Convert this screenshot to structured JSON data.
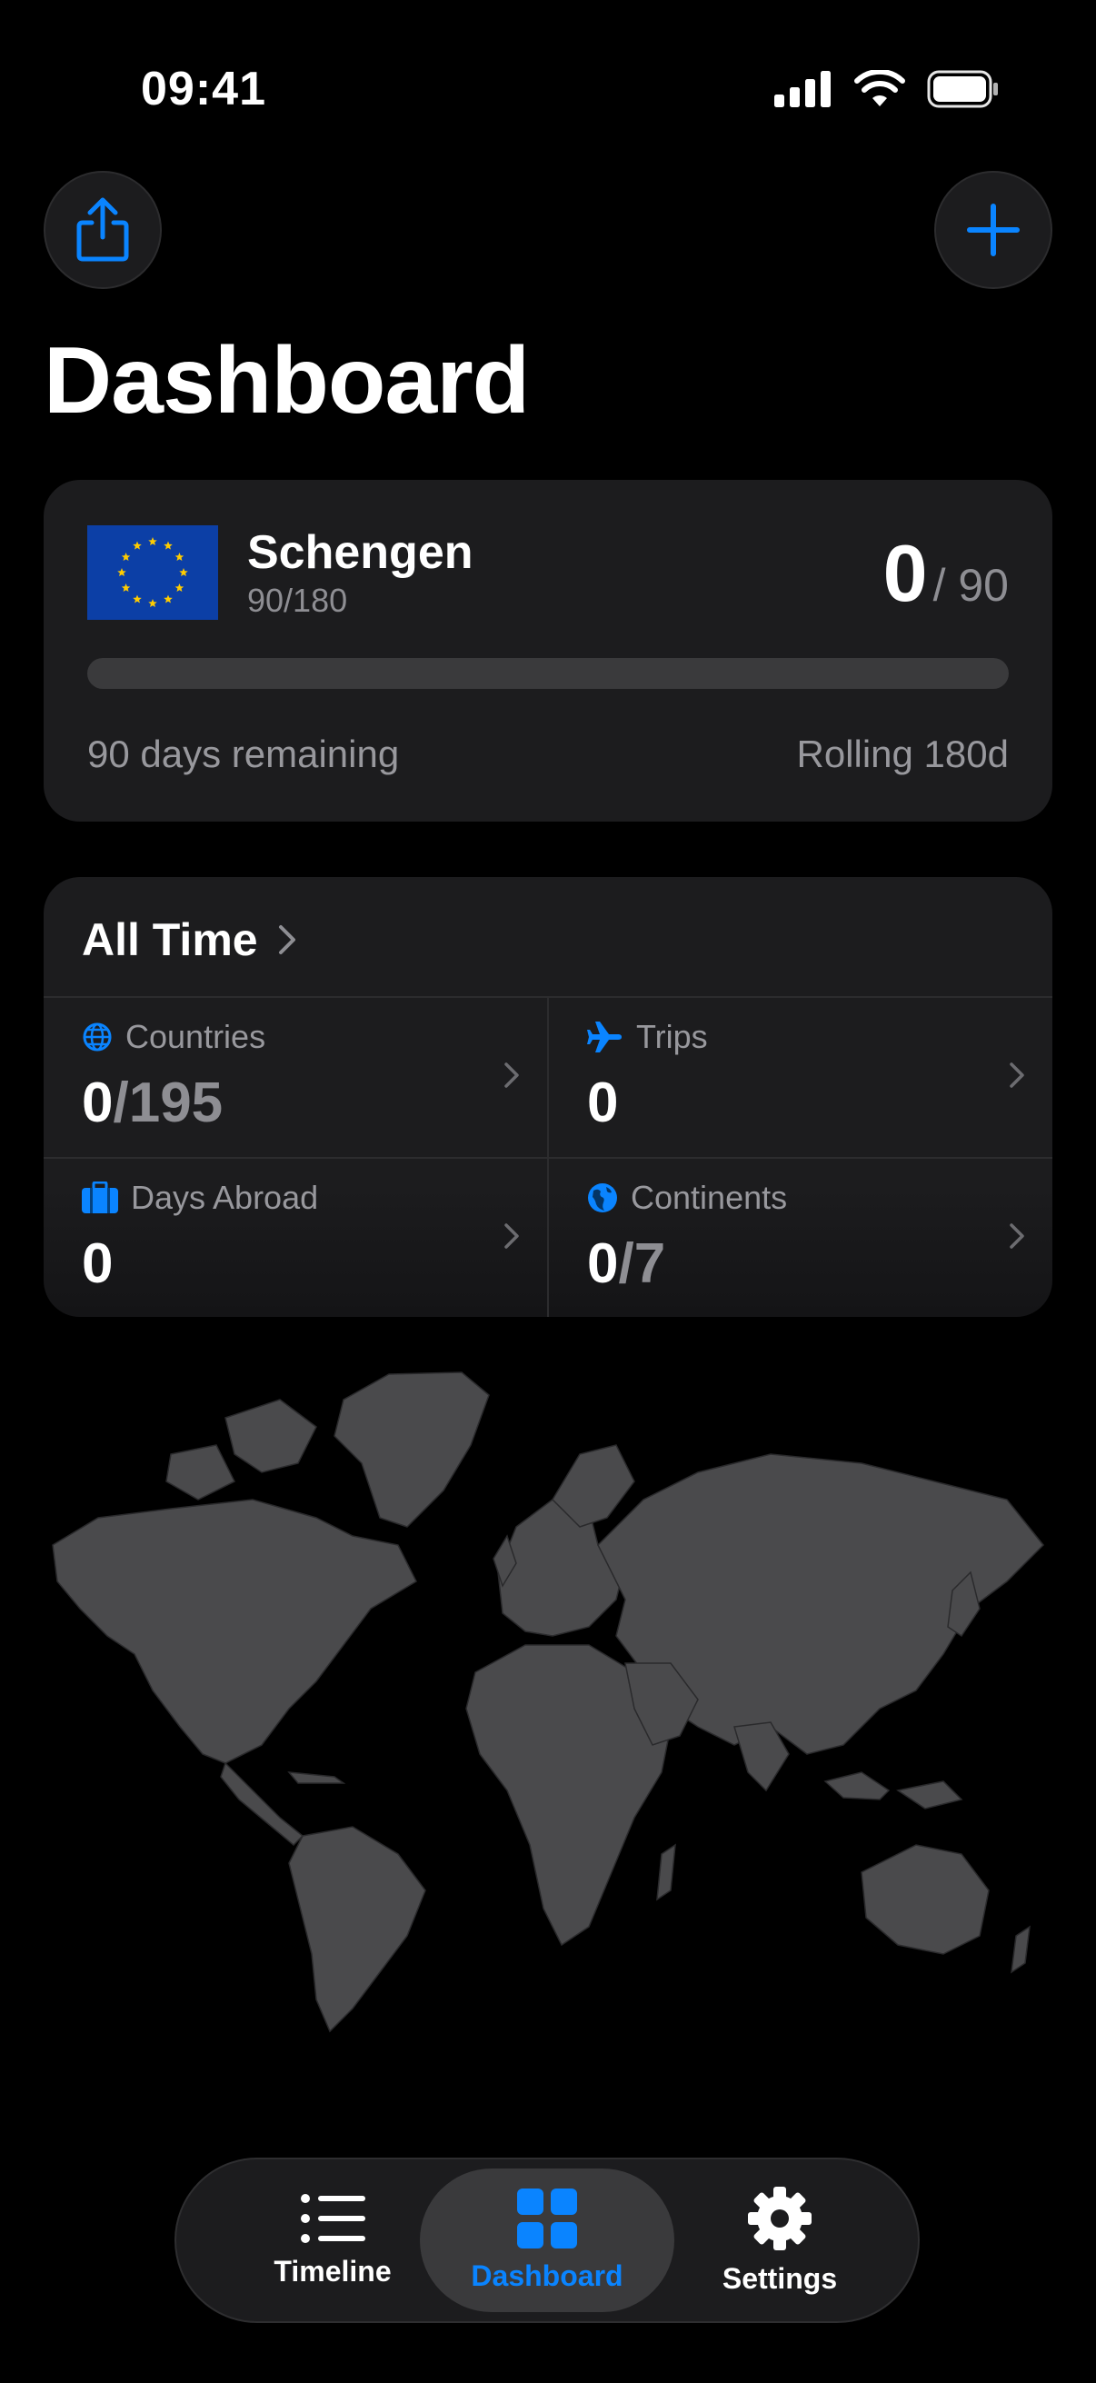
{
  "status_bar": {
    "time": "09:41"
  },
  "page": {
    "title": "Dashboard"
  },
  "schengen": {
    "name": "Schengen",
    "rule": "90/180",
    "used": "0",
    "limit": "/ 90",
    "progress_fraction": 0.0,
    "remaining_text": "90 days remaining",
    "window_text": "Rolling 180d"
  },
  "all_time": {
    "title": "All Time",
    "stats": {
      "countries": {
        "label": "Countries",
        "value": "0",
        "total": "/195"
      },
      "trips": {
        "label": "Trips",
        "value": "0"
      },
      "days_abroad": {
        "label": "Days Abroad",
        "value": "0"
      },
      "continents": {
        "label": "Continents",
        "value": "0",
        "total": "/7"
      }
    }
  },
  "tabs": [
    {
      "label": "Timeline",
      "icon": "list-icon"
    },
    {
      "label": "Dashboard",
      "icon": "grid-icon",
      "active": true
    },
    {
      "label": "Settings",
      "icon": "gear-icon"
    }
  ],
  "colors": {
    "accent": "#0a84ff",
    "card": "#1c1c1e",
    "land": "#4a4a4c",
    "flag_blue": "#0c3fa6",
    "flag_star": "#ffcc00"
  }
}
